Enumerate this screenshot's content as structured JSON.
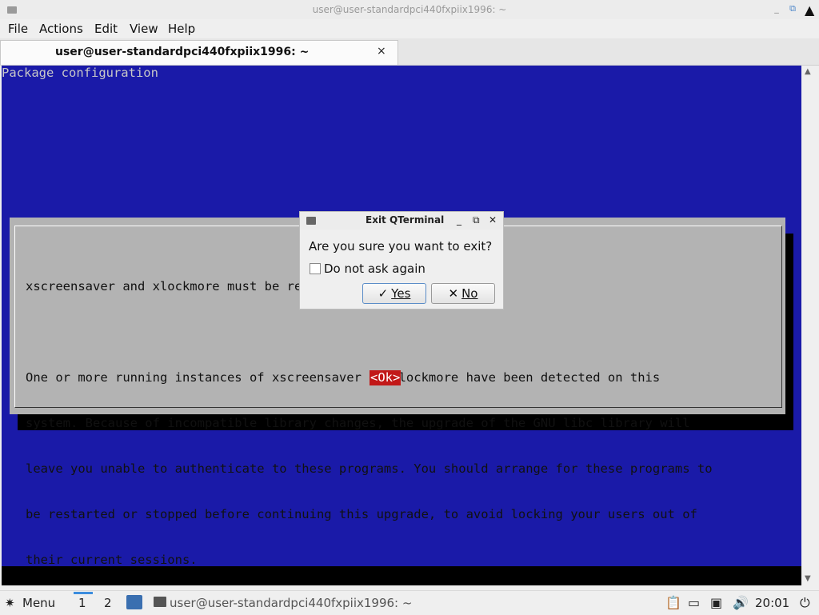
{
  "window": {
    "title": "user@user-standardpci440fxpiix1996: ~",
    "minimize_glyph": "_",
    "maximize_glyph": "⧉",
    "close_glyph": "×"
  },
  "menubar": {
    "items": [
      "File",
      "Actions",
      "Edit",
      "View",
      "Help"
    ]
  },
  "tab": {
    "label": "user@user-standardpci440fxpiix1996: ~",
    "close_glyph": "×"
  },
  "terminal": {
    "header": "Package configuration",
    "dialog_lines": [
      "xscreensaver and xlockmore must be restarted before upgrading",
      "",
      "One or more running instances of xscreensaver or xlockmore have been detected on this",
      "system. Because of incompatible library changes, the upgrade of the GNU libc library will",
      "leave you unable to authenticate to these programs. You should arrange for these programs to",
      "be restarted or stopped before continuing this upgrade, to avoid locking your users out of",
      "their current sessions."
    ],
    "ok_button": "<Ok>"
  },
  "exit_dialog": {
    "title": "Exit QTerminal",
    "message": "Are you sure you want to exit?",
    "checkbox_label": "Do not ask again",
    "checkbox_checked": false,
    "yes_label": "Yes",
    "no_label": "No",
    "yes_icon": "✓",
    "no_icon": "✕"
  },
  "taskbar": {
    "menu_label": "Menu",
    "workspaces": [
      "1",
      "2"
    ],
    "active_workspace": "1",
    "task_label": "user@user-standardpci440fxpiix1996: ~",
    "clock": "20:01"
  },
  "colors": {
    "terminal_bg": "#1a1aa8",
    "dialog_bg": "#b3b3b3",
    "ok_bg": "#c21818",
    "accent": "#3c8dde"
  }
}
